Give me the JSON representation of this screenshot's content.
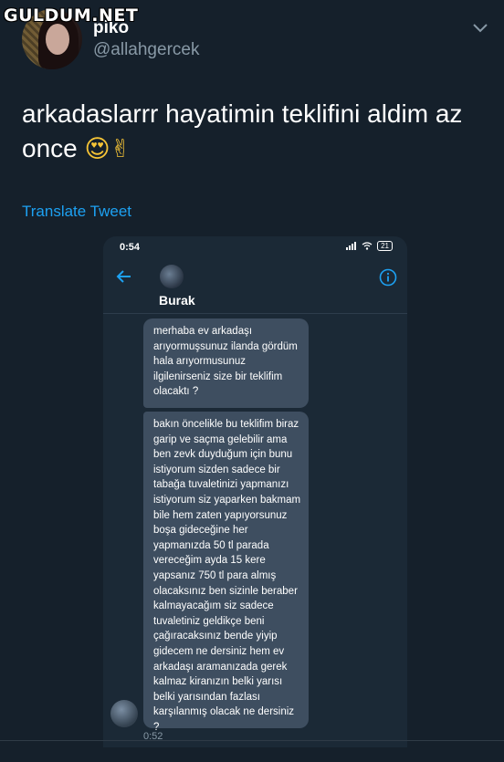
{
  "watermark": "GULDUM.NET",
  "tweet": {
    "display_name": "piko",
    "handle": "@allahgercek",
    "text_line1": "arkadaslarrr hayatimin teklifini aldim az",
    "text_line2": "once",
    "emojis": "😍✌",
    "translate_label": "Translate Tweet"
  },
  "phone": {
    "status_time": "0:54",
    "battery": "21",
    "contact_name": "Burak",
    "messages": [
      "merhaba ev arkadaşı\narıyormuşsunuz ilanda gördüm\nhala arıyormusunuz\nilgilenirseniz size bir teklifim\nolacaktı  ?",
      "bakın öncelikle bu teklifim biraz\ngarip ve saçma gelebilir ama\nben zevk duyduğum için bunu\nistiyorum sizden sadece bir\ntabağa tuvaletinizi yapmanızı\nistiyorum siz yaparken bakmam\nbile hem zaten yapıyorsunuz\nboşa gideceğine her\nyapmanızda 50 tl parada\nvereceğim ayda 15 kere\nyapsanız 750 tl para almış\nolacaksınız ben sizinle beraber\nkalmayacağım siz sadece\ntuvaletiniz geldikçe beni\nçağıracaksınız bende yiyip\ngidecem ne dersiniz hem ev\narkadaşı aramanızada gerek\nkalmaz kiranızın belki yarısı\nbelki yarısından fazlası\nkarşılanmış olacak ne dersiniz ?"
    ],
    "message_time": "0:52"
  },
  "colors": {
    "background": "#15202b",
    "link": "#1da1f2",
    "muted": "#8899a6",
    "bubble": "#3e4e60"
  }
}
